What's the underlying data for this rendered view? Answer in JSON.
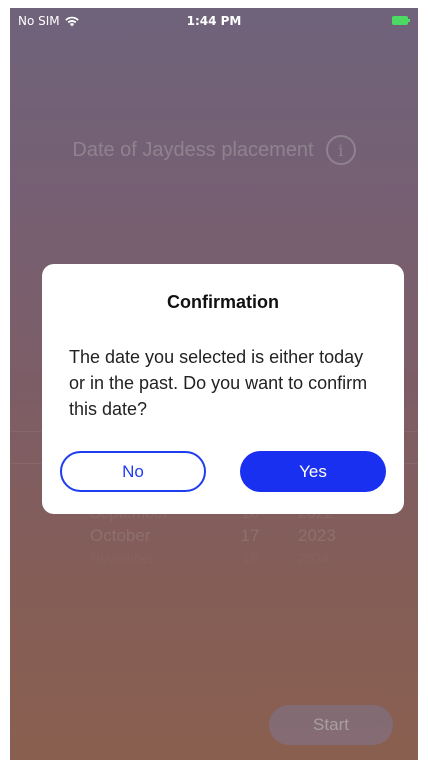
{
  "status_bar": {
    "carrier": "No SIM",
    "time": "1:44 PM",
    "wifi_icon": "wifi-icon",
    "battery_icon": "battery-charging-icon"
  },
  "screen": {
    "title": "Date of Jaydess placement",
    "info_icon": "i",
    "picker": {
      "rows": [
        {
          "month": "September",
          "day": "16",
          "year": "2022"
        },
        {
          "month": "October",
          "day": "17",
          "year": "2023"
        },
        {
          "month": "November",
          "day": "18",
          "year": "2024"
        }
      ],
      "selected_index": 1
    },
    "start_label": "Start"
  },
  "dialog": {
    "title": "Confirmation",
    "message": "The date you selected is either today or in the past. Do you want to confirm this date?",
    "no_label": "No",
    "yes_label": "Yes"
  },
  "colors": {
    "accent": "#1930f0",
    "battery": "#4cd964"
  }
}
